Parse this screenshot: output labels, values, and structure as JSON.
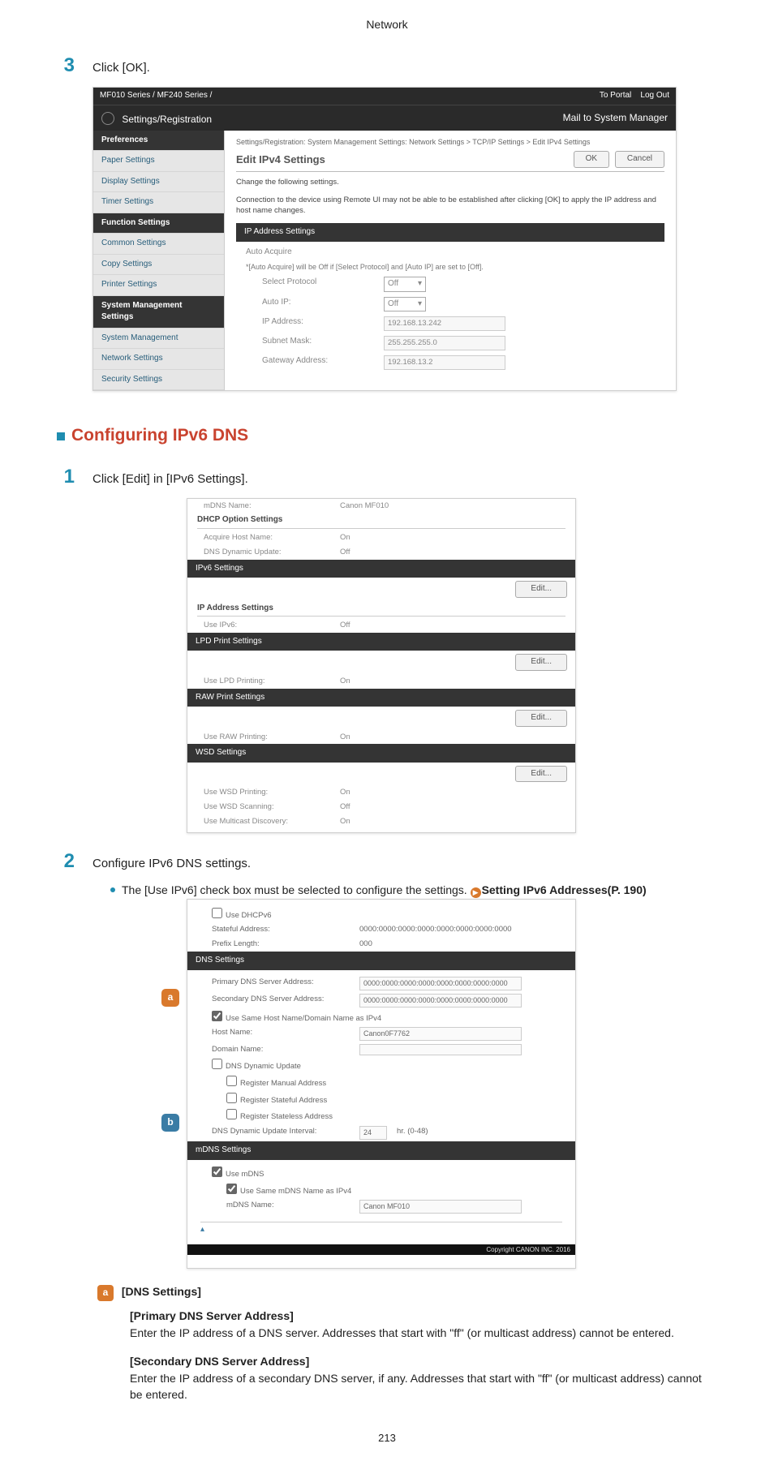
{
  "page": {
    "header": "Network",
    "pagenum": "213"
  },
  "step3": {
    "num": "3",
    "text": "Click [OK]."
  },
  "shot1": {
    "breadcrumb_top": "MF010 Series / MF240 Series /",
    "topright": {
      "portal": "To Portal",
      "logout": "Log Out"
    },
    "bar_title": "Settings/Registration",
    "bar_right": "Mail to System Manager",
    "side": {
      "pref": "Preferences",
      "items1": [
        "Paper Settings",
        "Display Settings",
        "Timer Settings"
      ],
      "func": "Function Settings",
      "items2": [
        "Common Settings",
        "Copy Settings",
        "Printer Settings"
      ],
      "sysm": "System Management Settings",
      "items3": [
        "System Management",
        "Network Settings",
        "Security Settings"
      ]
    },
    "main": {
      "crumb": "Settings/Registration: System Management Settings: Network Settings > TCP/IP Settings > Edit IPv4 Settings",
      "h": "Edit IPv4 Settings",
      "ok": "OK",
      "cancel": "Cancel",
      "note1": "Change the following settings.",
      "note2": "Connection to the device using Remote UI may not be able to be established after clicking [OK] to apply the IP address and host name changes.",
      "strip": "IP Address Settings",
      "auto_lbl": "Auto Acquire",
      "auto_note": "*[Auto Acquire] will be Off if [Select Protocol] and [Auto IP] are set to [Off].",
      "selprot_lbl": "Select Protocol",
      "selprot_val": "Off",
      "autoip_lbl": "Auto IP:",
      "autoip_val": "Off",
      "ipaddr_lbl": "IP Address:",
      "ipaddr_val": "192.168.13.242",
      "subnet_lbl": "Subnet Mask:",
      "subnet_val": "255.255.255.0",
      "gw_lbl": "Gateway Address:",
      "gw_val": "192.168.13.2"
    }
  },
  "sect": {
    "title": "Configuring IPv6 DNS"
  },
  "step1": {
    "num": "1",
    "text": "Click [Edit] in [IPv6 Settings]."
  },
  "shot2": {
    "mdns_lbl": "mDNS Name:",
    "mdns_val": "Canon MF010",
    "dhcp_hdr": "DHCP Option Settings",
    "ahn_lbl": "Acquire Host Name:",
    "ahn_val": "On",
    "ddu_lbl": "DNS Dynamic Update:",
    "ddu_val": "Off",
    "ipv6_strip": "IPv6 Settings",
    "ipaddr_sub": "IP Address Settings",
    "useipv6_lbl": "Use IPv6:",
    "useipv6_val": "Off",
    "lpd_strip": "LPD Print Settings",
    "lpd_lbl": "Use LPD Printing:",
    "lpd_val": "On",
    "raw_strip": "RAW Print Settings",
    "raw_lbl": "Use RAW Printing:",
    "raw_val": "On",
    "wsd_strip": "WSD Settings",
    "wsdp_lbl": "Use WSD Printing:",
    "wsdp_val": "On",
    "wsds_lbl": "Use WSD Scanning:",
    "wsds_val": "Off",
    "wsdm_lbl": "Use Multicast Discovery:",
    "wsdm_val": "On",
    "edit": "Edit..."
  },
  "step2": {
    "num": "2",
    "text": "Configure IPv6 DNS settings.",
    "bullet_pre": "The [Use IPv6] check box must be selected to configure the settings. ",
    "bullet_link": "Setting IPv6 Addresses(P. 190)"
  },
  "shot3": {
    "usedhcpv6": "Use DHCPv6",
    "stful_lbl": "Stateful Address:",
    "stful_val": "0000:0000:0000:0000:0000:0000:0000:0000",
    "plen_lbl": "Prefix Length:",
    "plen_val": "000",
    "dns_strip": "DNS Settings",
    "pdns_lbl": "Primary DNS Server Address:",
    "pdns_val": "0000:0000:0000:0000:0000:0000:0000:0000",
    "sdns_lbl": "Secondary DNS Server Address:",
    "sdns_val": "0000:0000:0000:0000:0000:0000:0000:0000",
    "samehost": "Use Same Host Name/Domain Name as IPv4",
    "hname_lbl": "Host Name:",
    "hname_val": "Canon0F7762",
    "dname_lbl": "Domain Name:",
    "dnsdyn": "DNS Dynamic Update",
    "regman": "Register Manual Address",
    "regstf": "Register Stateful Address",
    "regstl": "Register Stateless Address",
    "dint_lbl": "DNS Dynamic Update Interval:",
    "dint_val": "24",
    "dint_unit": "hr. (0-48)",
    "mdns_strip": "mDNS Settings",
    "usemdns": "Use mDNS",
    "samemdns": "Use Same mDNS Name as IPv4",
    "mdnsname_lbl": "mDNS Name:",
    "mdnsname_val": "Canon MF010",
    "copy": "Copyright CANON INC. 2016"
  },
  "dns": {
    "a": "a",
    "title": "[DNS Settings]",
    "primary_h": "[Primary DNS Server Address]",
    "primary_p": "Enter the IP address of a DNS server. Addresses that start with \"ff\" (or multicast address) cannot be entered.",
    "secondary_h": "[Secondary DNS Server Address]",
    "secondary_p": "Enter the IP address of a secondary DNS server, if any. Addresses that start with \"ff\" (or multicast address) cannot be entered."
  }
}
